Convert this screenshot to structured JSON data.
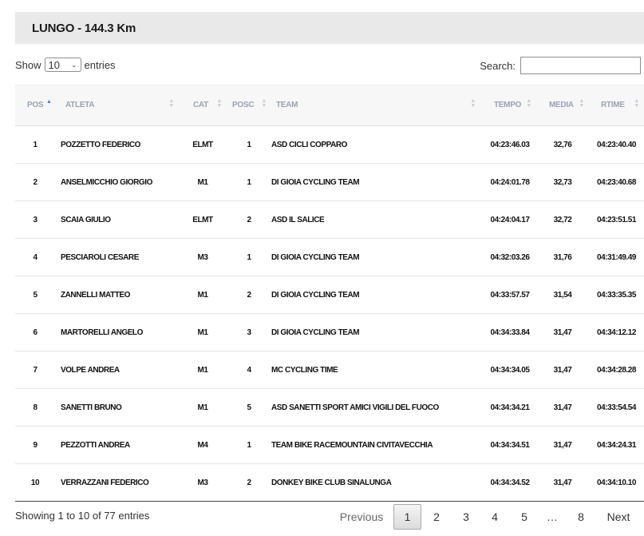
{
  "title": "LUNGO - 144.3 Km",
  "length_menu": {
    "prefix": "Show",
    "value": "10",
    "suffix": "entries"
  },
  "search": {
    "label": "Search:",
    "value": ""
  },
  "columns": [
    "POS",
    "ATLETA",
    "CAT",
    "POSC",
    "TEAM",
    "TEMPO",
    "MEDIA",
    "RTIME"
  ],
  "rows": [
    [
      "1",
      "POZZETTO FEDERICO",
      "ELMT",
      "1",
      "ASD CICLI COPPARO",
      "04:23:46.03",
      "32,76",
      "04:23:40.40"
    ],
    [
      "2",
      "ANSELMICCHIO GIORGIO",
      "M1",
      "1",
      "DI GIOIA CYCLING TEAM",
      "04:24:01.78",
      "32,73",
      "04:23:40.68"
    ],
    [
      "3",
      "SCAIA GIULIO",
      "ELMT",
      "2",
      "ASD IL SALICE",
      "04:24:04.17",
      "32,72",
      "04:23:51.51"
    ],
    [
      "4",
      "PESCIAROLI CESARE",
      "M3",
      "1",
      "DI GIOIA CYCLING TEAM",
      "04:32:03.26",
      "31,76",
      "04:31:49.49"
    ],
    [
      "5",
      "ZANNELLI MATTEO",
      "M1",
      "2",
      "DI GIOIA CYCLING TEAM",
      "04:33:57.57",
      "31,54",
      "04:33:35.35"
    ],
    [
      "6",
      "MARTORELLI ANGELO",
      "M1",
      "3",
      "DI GIOIA CYCLING TEAM",
      "04:34:33.84",
      "31,47",
      "04:34:12.12"
    ],
    [
      "7",
      "VOLPE ANDREA",
      "M1",
      "4",
      "MC CYCLING TIME",
      "04:34:34.05",
      "31,47",
      "04:34:28.28"
    ],
    [
      "8",
      "SANETTI BRUNO",
      "M1",
      "5",
      "ASD SANETTI SPORT AMICI VIGILI DEL FUOCO",
      "04:34:34.21",
      "31,47",
      "04:33:54.54"
    ],
    [
      "9",
      "PEZZOTTI ANDREA",
      "M4",
      "1",
      "TEAM BIKE RACEMOUNTAIN CIVITAVECCHIA",
      "04:34:34.51",
      "31,47",
      "04:34:24.31"
    ],
    [
      "10",
      "VERRAZZANI FEDERICO",
      "M3",
      "2",
      "DONKEY BIKE CLUB SINALUNGA",
      "04:34:34.52",
      "31,47",
      "04:34:10.10"
    ]
  ],
  "info": "Showing 1 to 10 of 77 entries",
  "pagination": {
    "previous": "Previous",
    "pages": [
      "1",
      "2",
      "3",
      "4",
      "5",
      "…",
      "8"
    ],
    "current": "1",
    "next": "Next"
  },
  "colors": {
    "title_bg": "#e9e9e9",
    "header_bg": "#f7f7f7",
    "header_text": "#9aa3b0",
    "sort_active": "#4a7bd6"
  }
}
